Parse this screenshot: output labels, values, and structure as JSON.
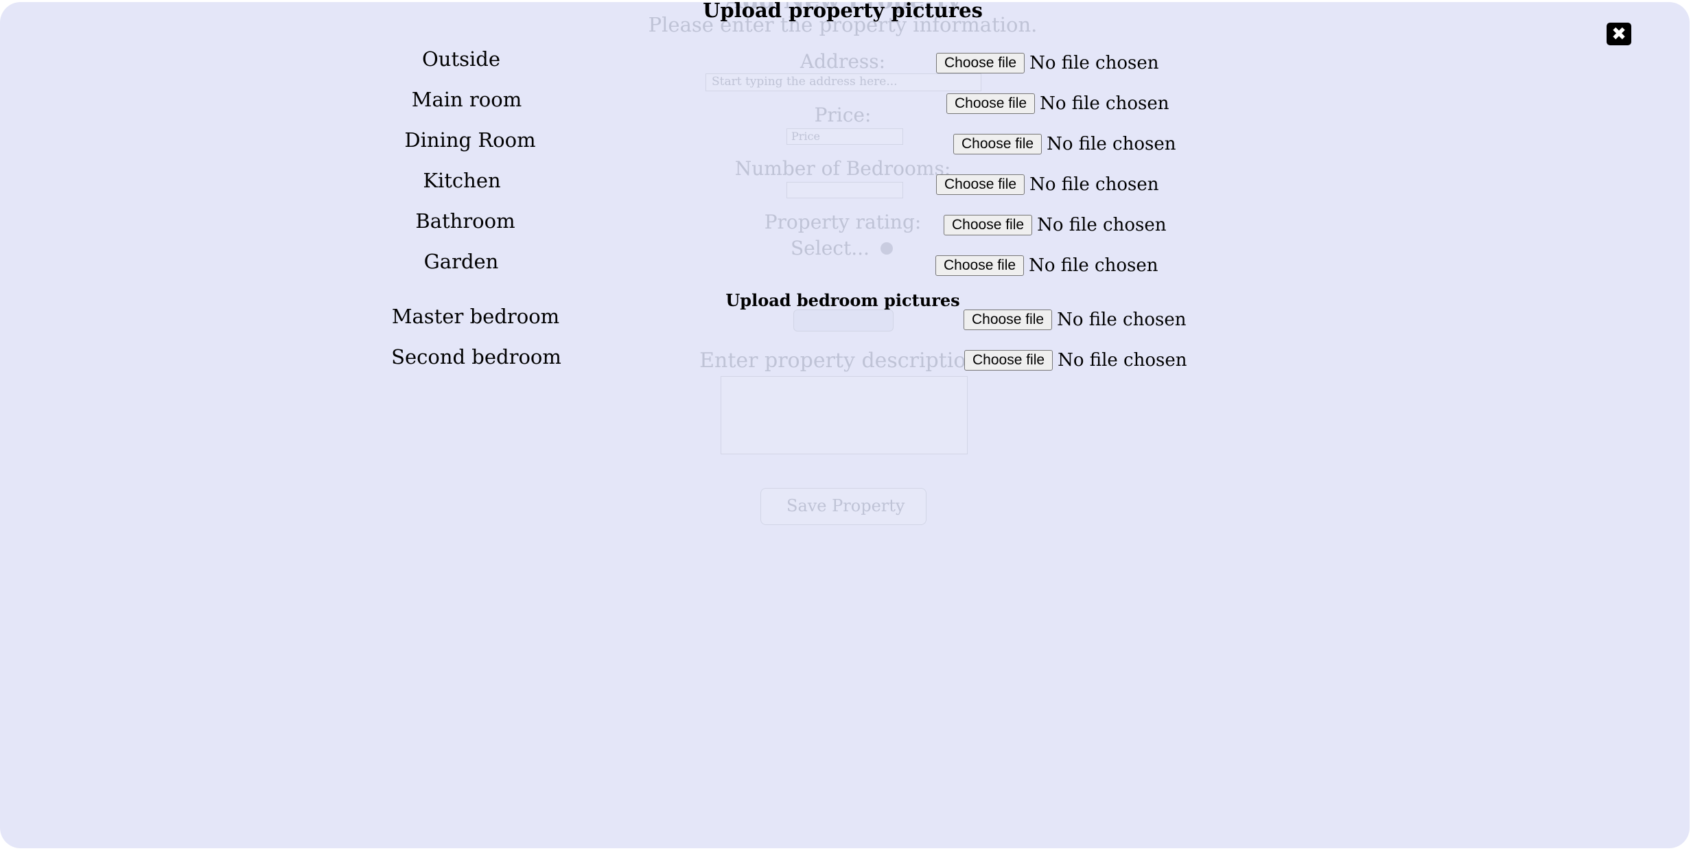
{
  "background_form": {
    "title": "Add New Property",
    "intro": "Please enter the property information.",
    "address_label": "Address:",
    "address_placeholder": "Start typing the address here...",
    "price_label": "Price:",
    "price_placeholder": "Price",
    "bedrooms_label": "Number of Bedrooms:",
    "rating_label": "Property rating:",
    "rating_select": "Select...",
    "description_label": "Enter property description:",
    "save_button": "Save Property"
  },
  "upload_modal": {
    "title": "Upload property pictures",
    "bedroom_section_title": "Upload bedroom pictures",
    "choose_file_label": "Choose file",
    "no_file_label": "No file chosen",
    "rooms": [
      "Outside",
      "Main room",
      "Dining Room",
      "Kitchen",
      "Bathroom",
      "Garden"
    ],
    "bedrooms": [
      "Master bedroom",
      "Second bedroom"
    ],
    "close_icon": "close-icon"
  },
  "colors": {
    "modal_background": "#e4e6f8",
    "faded_text": "#bfc3d6"
  }
}
